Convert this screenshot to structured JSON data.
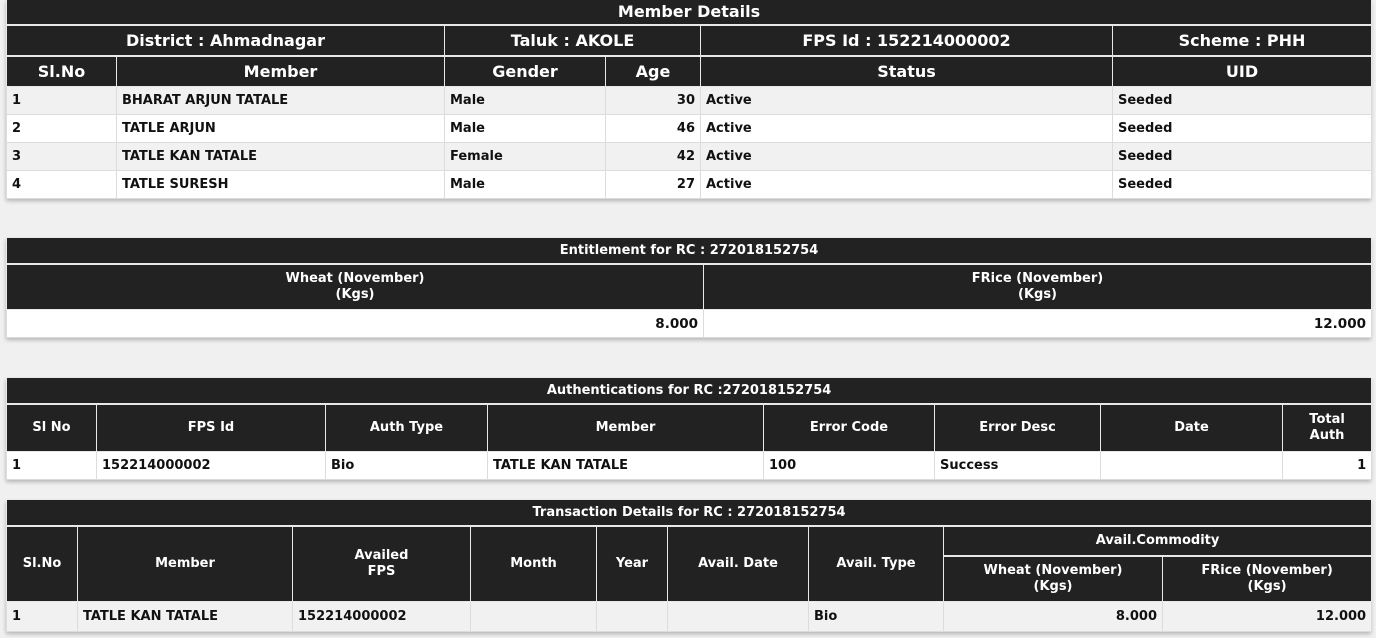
{
  "member_details": {
    "title": "Member Details",
    "district": "District : Ahmadnagar",
    "taluk": "Taluk : AKOLE",
    "fps_id": "FPS Id : 152214000002",
    "scheme": "Scheme : PHH",
    "columns": [
      "Sl.No",
      "Member",
      "Gender",
      "Age",
      "Status",
      "UID"
    ],
    "rows": [
      {
        "sl": "1",
        "member": "BHARAT ARJUN TATALE",
        "gender": "Male",
        "age": "30",
        "status": "Active",
        "uid": "Seeded"
      },
      {
        "sl": "2",
        "member": "TATLE ARJUN",
        "gender": "Male",
        "age": "46",
        "status": "Active",
        "uid": "Seeded"
      },
      {
        "sl": "3",
        "member": "TATLE KAN TATALE",
        "gender": "Female",
        "age": "42",
        "status": "Active",
        "uid": "Seeded"
      },
      {
        "sl": "4",
        "member": "TATLE SURESH",
        "gender": "Male",
        "age": "27",
        "status": "Active",
        "uid": "Seeded"
      }
    ]
  },
  "entitlement": {
    "title": "Entitlement for RC : 272018152754",
    "columns": [
      {
        "line1": "Wheat (November)",
        "line2": "(Kgs)"
      },
      {
        "line1": "FRice (November)",
        "line2": "(Kgs)"
      }
    ],
    "values": [
      "8.000",
      "12.000"
    ]
  },
  "authentications": {
    "title": "Authentications for RC :272018152754",
    "columns": [
      "Sl No",
      "FPS Id",
      "Auth Type",
      "Member",
      "Error Code",
      "Error Desc",
      "Date"
    ],
    "total_auth": {
      "line1": "Total",
      "line2": "Auth"
    },
    "rows": [
      {
        "sl": "1",
        "fps_id": "152214000002",
        "auth_type": "Bio",
        "member": "TATLE KAN TATALE",
        "error_code": "100",
        "error_desc": "Success",
        "date": "",
        "total_auth": "1"
      }
    ]
  },
  "transactions": {
    "title": "Transaction Details for RC : 272018152754",
    "columns": {
      "sl": "Sl.No",
      "member": "Member",
      "availed_fps": {
        "line1": "Availed",
        "line2": "FPS"
      },
      "month": "Month",
      "year": "Year",
      "avail_date": "Avail. Date",
      "avail_type": "Avail. Type",
      "avail_commodity": "Avail.Commodity",
      "wheat": {
        "line1": "Wheat (November)",
        "line2": "(Kgs)"
      },
      "frice": {
        "line1": "FRice (November)",
        "line2": "(Kgs)"
      }
    },
    "rows": [
      {
        "sl": "1",
        "member": "TATLE KAN TATALE",
        "availed_fps": "152214000002",
        "month": "",
        "year": "",
        "avail_date": "",
        "avail_type": "Bio",
        "wheat": "8.000",
        "frice": "12.000"
      }
    ]
  }
}
